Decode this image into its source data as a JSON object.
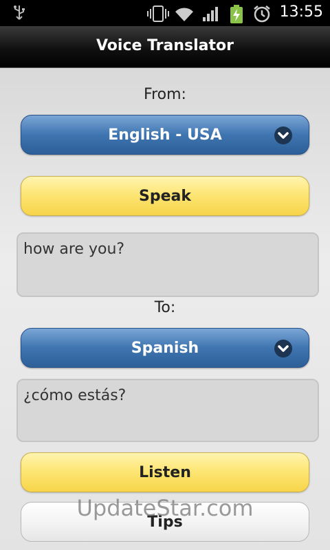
{
  "status_bar": {
    "time": "13:55",
    "icons": [
      "usb-icon",
      "vibrate-icon",
      "wifi-icon",
      "signal-icon",
      "battery-charging-icon",
      "alarm-icon"
    ]
  },
  "app": {
    "title": "Voice Translator"
  },
  "from": {
    "label": "From:",
    "language": "English - USA",
    "speak_label": "Speak",
    "input_text": "how are you?"
  },
  "to": {
    "label": "To:",
    "language": "Spanish",
    "output_text": "¿cómo estás?",
    "listen_label": "Listen"
  },
  "tips_label": "Tips",
  "watermark": "UpdateStar.com",
  "colors": {
    "primary_blue": "#3f75b0",
    "accent_yellow": "#fde676",
    "title_bar": "#000000"
  }
}
